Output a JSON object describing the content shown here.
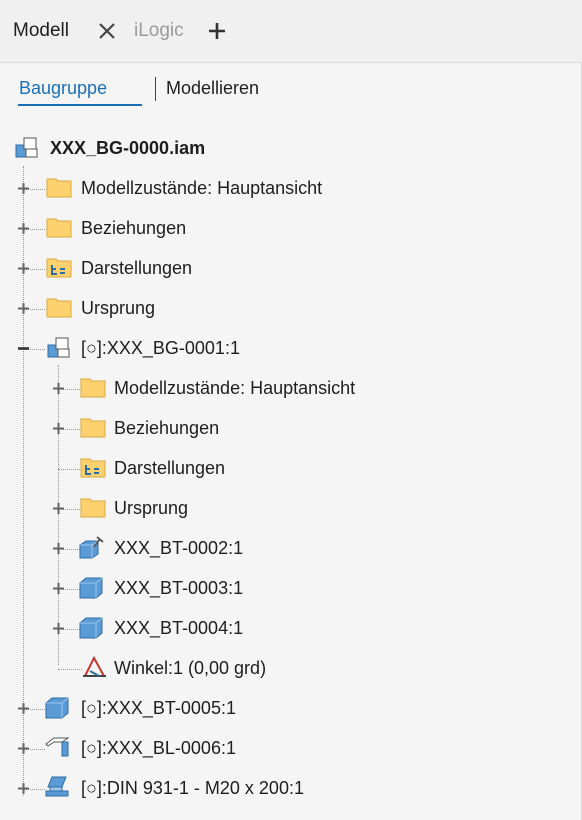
{
  "tabs": {
    "modell": "Modell",
    "ilogic": "iLogic"
  },
  "modes": {
    "baugruppe": "Baugruppe",
    "modellieren": "Modellieren"
  },
  "tree": {
    "root": "XXX_BG-0000.iam",
    "items": [
      {
        "label": "Modellzustände: Hauptansicht",
        "icon": "folder-icon"
      },
      {
        "label": "Beziehungen",
        "icon": "folder-icon"
      },
      {
        "label": "Darstellungen",
        "icon": "representations-folder-icon"
      },
      {
        "label": "Ursprung",
        "icon": "folder-icon"
      },
      {
        "label": "[○]:XXX_BG-0001:1",
        "icon": "assembly-icon"
      },
      {
        "label": "Modellzustände: Hauptansicht",
        "icon": "folder-icon"
      },
      {
        "label": "Beziehungen",
        "icon": "folder-icon"
      },
      {
        "label": "Darstellungen",
        "icon": "representations-folder-icon"
      },
      {
        "label": "Ursprung",
        "icon": "folder-icon"
      },
      {
        "label": "XXX_BT-0002:1",
        "icon": "part-pinned-icon"
      },
      {
        "label": "XXX_BT-0003:1",
        "icon": "part-icon"
      },
      {
        "label": "XXX_BT-0004:1",
        "icon": "part-icon"
      },
      {
        "label": "Winkel:1 (0,00 grd)",
        "icon": "angle-constraint-icon"
      },
      {
        "label": "[○]:XXX_BT-0005:1",
        "icon": "part-icon"
      },
      {
        "label": "[○]:XXX_BL-0006:1",
        "icon": "sheetmetal-icon"
      },
      {
        "label": "[○]:DIN 931-1 - M20 x 200:1",
        "icon": "content-center-icon"
      }
    ]
  }
}
